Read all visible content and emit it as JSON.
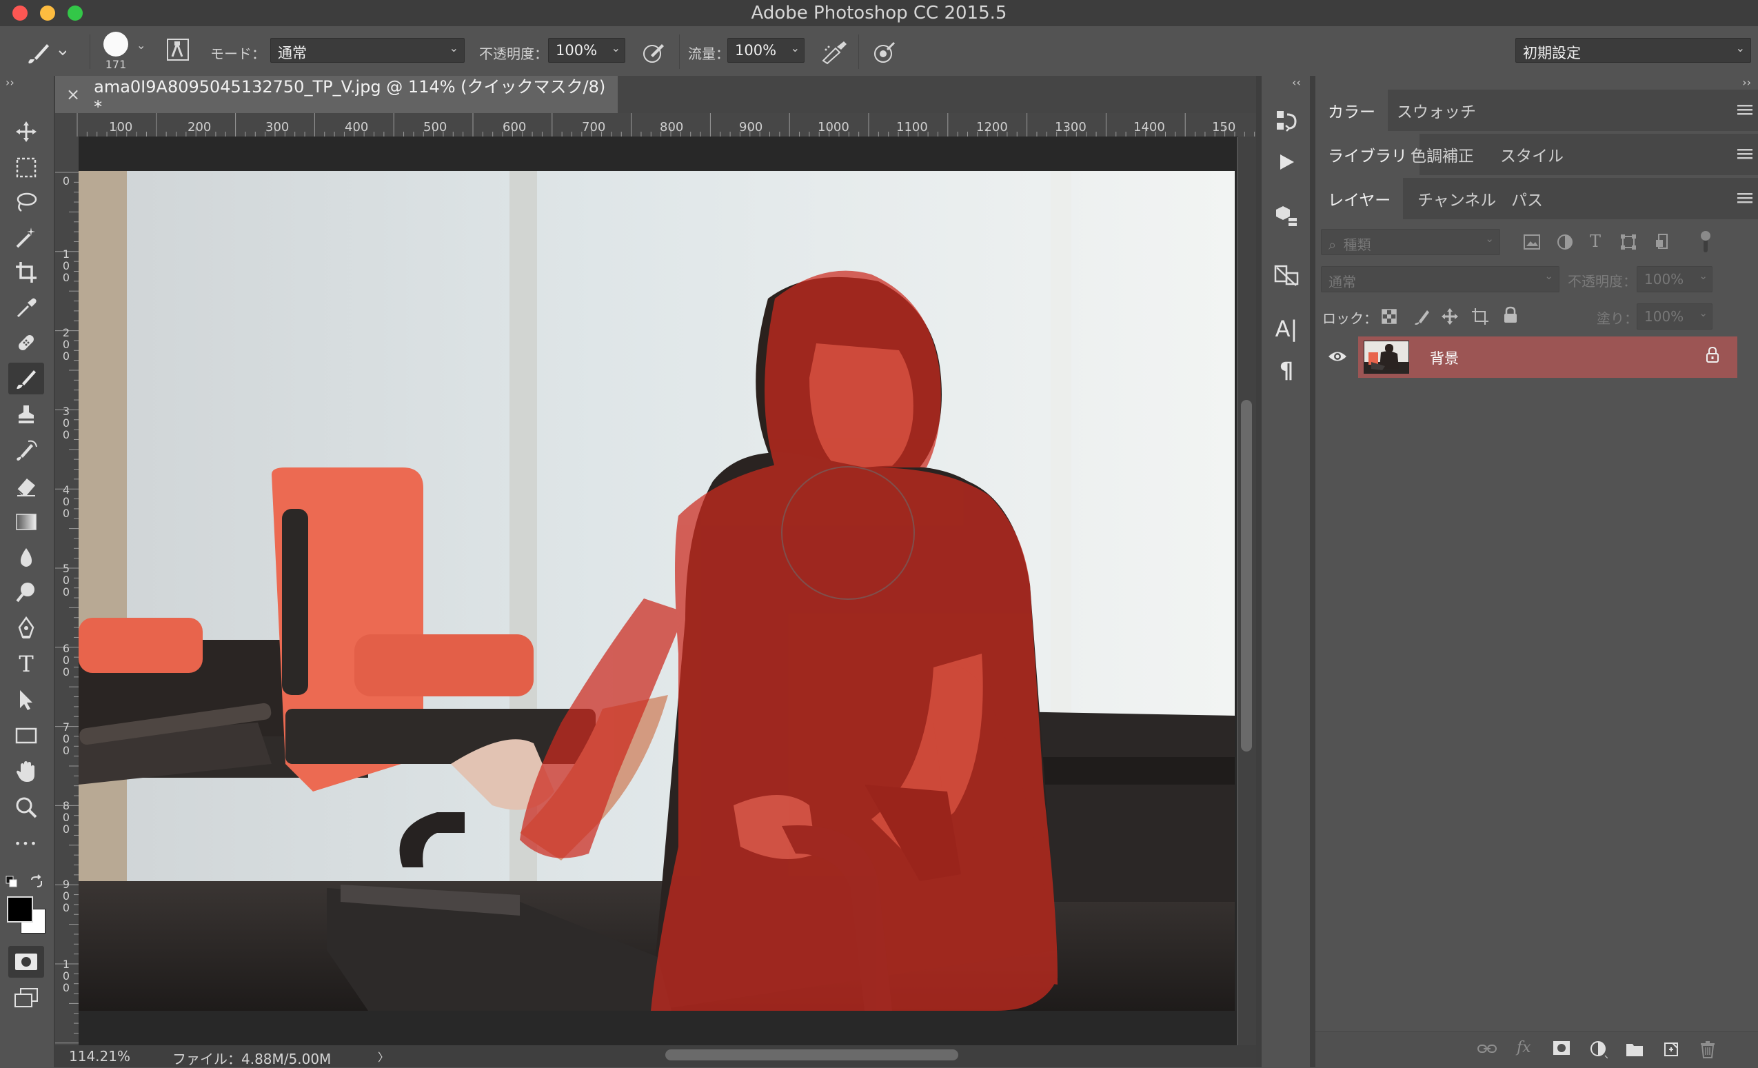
{
  "window": {
    "title": "Adobe Photoshop CC 2015.5",
    "traffic_colors": {
      "close": "#fc5753",
      "minimize": "#fdbc40",
      "zoom": "#33c748"
    }
  },
  "options_bar": {
    "brush_size": "171",
    "mode_label": "モード：",
    "mode_value": "通常",
    "opacity_label": "不透明度：",
    "opacity_value": "100%",
    "flow_label": "流量：",
    "flow_value": "100%",
    "workspace_value": "初期設定"
  },
  "document": {
    "tab_title": "ama0I9A8095045132750_TP_V.jpg @ 114% (クイックマスク/8) *",
    "close_icon": "×",
    "ruler_top": [
      "100",
      "200",
      "300",
      "400",
      "500",
      "600",
      "700",
      "800",
      "900",
      "1000",
      "1100",
      "1200",
      "1300",
      "1400",
      "150"
    ],
    "ruler_left": [
      "0",
      "1\n0\n0",
      "2\n0\n0",
      "3\n0\n0",
      "4\n0\n0",
      "5\n0\n0",
      "6\n0\n0",
      "7\n0\n0",
      "8\n0\n0",
      "9\n0\n0",
      "1\n0\n0"
    ],
    "quickmask_color": "#cc2a1e"
  },
  "status_bar": {
    "zoom": "114.21%",
    "file_info": "ファイル：4.88M/5.00M",
    "arrow": "〉"
  },
  "panels": {
    "row1_tabs": [
      "カラー",
      "スウォッチ"
    ],
    "row2_tabs": [
      "ライブラリ",
      "色調補正",
      "スタイル"
    ],
    "row3_tabs": [
      "レイヤー",
      "チャンネル",
      "パス"
    ],
    "filter_placeholder": "種類",
    "blend_mode": "通常",
    "opacity_label": "不透明度：",
    "opacity_value": "100%",
    "lock_label": "ロック：",
    "fill_label": "塗り：",
    "fill_value": "100%",
    "layer_name": "背景",
    "layer_selected_color": "#9c5554"
  },
  "dock": {
    "text_icon": "A|",
    "paragraph_icon": "¶"
  },
  "toolbar_text": {
    "type_tool": "T",
    "more_tools": "•••"
  }
}
